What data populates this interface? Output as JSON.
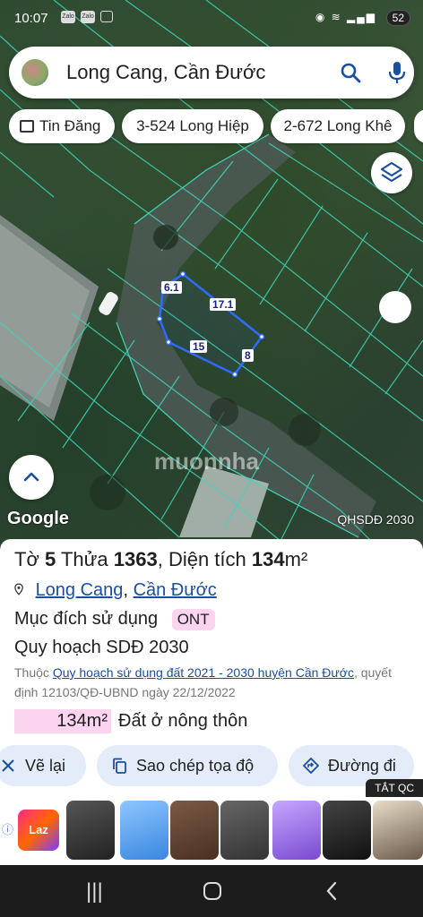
{
  "status_bar": {
    "time": "10:07",
    "app_icons": [
      "Zalo",
      "Zalo"
    ],
    "battery": "52"
  },
  "search": {
    "query": "Long Cang, Cần Đước"
  },
  "chips": [
    "Tin Đăng",
    "3-524 Long Hiệp",
    "2-672 Long Khê"
  ],
  "map": {
    "lot_edges": [
      "6.1",
      "17.1",
      "15",
      "8"
    ],
    "watermark": "muonnha",
    "attribution": "Google",
    "layer_label": "QHSDĐ 2030"
  },
  "parcel": {
    "sheet_label": "Tờ",
    "sheet_no": "5",
    "lot_label": "Thửa",
    "lot_no": "1363",
    "area_label": "Diện tích",
    "area_value": "134",
    "area_unit": "m²",
    "location": {
      "commune": "Long Cang",
      "separator": ",",
      "district": "Cần Đước"
    },
    "usage_label": "Mục đích sử dụng",
    "usage_code": "ONT",
    "plan_label": "Quy hoạch SDĐ 2030",
    "plan_prefix": "Thuộc",
    "plan_link": "Quy hoạch sử dụng đất 2021 - 2030 huyện Cần Đước",
    "plan_decision": ", quyết định 12103/QĐ-UBND ngày 22/12/2022",
    "zone_area": "134m²",
    "zone_name": "Đất ở nông thôn"
  },
  "actions": [
    "Vẽ lại",
    "Sao chép tọa độ",
    "Đường đi"
  ],
  "ad": {
    "close_label": "TẮT QC",
    "brand": "Laz"
  },
  "colors": {
    "link": "#1a4ea0",
    "badge": "#fbd4f0",
    "action_bg": "#e3ecf8",
    "lot_outline": "#2f6bff",
    "grid": "#3fd6b8"
  }
}
